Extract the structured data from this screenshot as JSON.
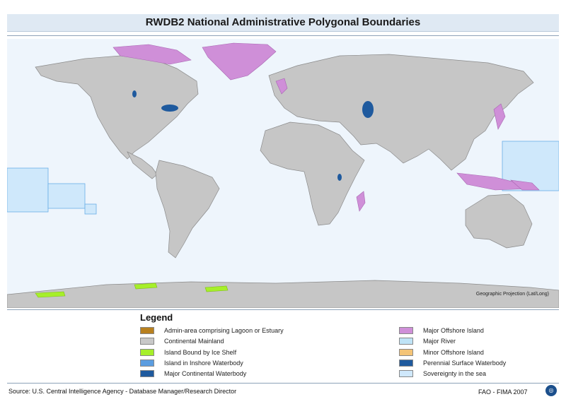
{
  "title": "RWDB2 National Administrative Polygonal Boundaries",
  "map": {
    "projection_label": "Geographic Projection (Lat/Long)"
  },
  "legend": {
    "title": "Legend",
    "items_left": [
      {
        "label": "Admin-area comprising Lagoon or Estuary",
        "color": "#b8801f"
      },
      {
        "label": "Continental Mainland",
        "color": "#c8c8c8"
      },
      {
        "label": "Island Bound by Ice Shelf",
        "color": "#a6ef2a"
      },
      {
        "label": "Island in Inshore Waterbody",
        "color": "#5b9de0"
      },
      {
        "label": "Major Continental Waterbody",
        "color": "#1f5a9e"
      }
    ],
    "items_right": [
      {
        "label": "Major Offshore Island",
        "color": "#cf8fd8"
      },
      {
        "label": "Major River",
        "color": "#bfe3f6"
      },
      {
        "label": "Minor Offshore Island",
        "color": "#f4c477"
      },
      {
        "label": "Perennial Surface Waterbody",
        "color": "#1f5a9e"
      },
      {
        "label": "Sovereignty in the sea",
        "color": "#cfe8fb"
      }
    ]
  },
  "footer": {
    "source": "Source: U.S. Central Intelligence Agency - Database Manager/Research Director",
    "credit": "FAO -  FIMA  2007",
    "logo_icon": "fao-logo-icon"
  }
}
